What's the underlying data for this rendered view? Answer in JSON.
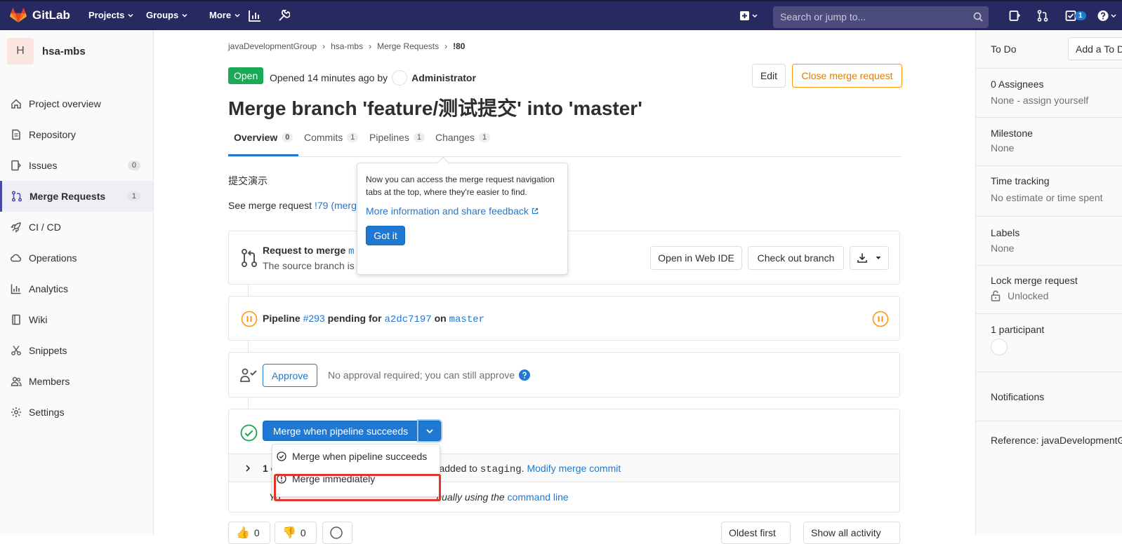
{
  "topbar": {
    "brand": "GitLab",
    "nav": [
      {
        "label": "Projects"
      },
      {
        "label": "Groups"
      },
      {
        "label": "More"
      }
    ],
    "search_placeholder": "Search or jump to...",
    "todo_count": "1",
    "colors": {
      "bg": "#292961",
      "accent": "#1f78d1"
    }
  },
  "sidebar": {
    "project_initial": "H",
    "project_name": "hsa-mbs",
    "items": [
      {
        "label": "Project overview",
        "icon": "home-icon"
      },
      {
        "label": "Repository",
        "icon": "document-icon"
      },
      {
        "label": "Issues",
        "icon": "issues-icon",
        "count": "0"
      },
      {
        "label": "Merge Requests",
        "icon": "merge-request-icon",
        "count": "1"
      },
      {
        "label": "CI / CD",
        "icon": "rocket-icon"
      },
      {
        "label": "Operations",
        "icon": "cloud-icon"
      },
      {
        "label": "Analytics",
        "icon": "chart-icon"
      },
      {
        "label": "Wiki",
        "icon": "book-icon"
      },
      {
        "label": "Snippets",
        "icon": "scissors-icon"
      },
      {
        "label": "Members",
        "icon": "users-icon"
      },
      {
        "label": "Settings",
        "icon": "gear-icon"
      }
    ]
  },
  "breadcrumb": [
    "javaDevelopmentGroup",
    "hsa-mbs",
    "Merge Requests",
    "!80"
  ],
  "mr": {
    "status": "Open",
    "opened_text": "Opened 14 minutes ago by",
    "author": "Administrator",
    "edit_label": "Edit",
    "close_label": "Close merge request",
    "title": "Merge branch 'feature/测试提交' into 'master'",
    "tabs": [
      {
        "label": "Overview",
        "count": "0"
      },
      {
        "label": "Commits",
        "count": "1"
      },
      {
        "label": "Pipelines",
        "count": "1"
      },
      {
        "label": "Changes",
        "count": "1"
      }
    ],
    "description": "提交演示",
    "see_prefix": "See merge request",
    "see_link": "!79 (merg"
  },
  "popover": {
    "text": "Now you can access the merge request navigation tabs at the top, where they're easier to find.",
    "link": "More information and share feedback",
    "button": "Got it"
  },
  "request_card": {
    "title": "Request to merge",
    "title_link": "m",
    "subtitle": "The source branch is",
    "web_ide_label": "Open in Web IDE",
    "checkout_label": "Check out branch"
  },
  "pipeline": {
    "prefix": "Pipeline",
    "id": "#293",
    "pending_for": "pending for",
    "commit": "a2dc7197",
    "on": "on",
    "branch": "master"
  },
  "approval": {
    "button": "Approve",
    "text": "No approval required; you can still approve"
  },
  "merge": {
    "button": "Merge when pipeline succeeds",
    "dropdown": [
      "Merge when pipeline succeeds",
      "Merge immediately"
    ],
    "commit_prefix": "1 c",
    "commit_text": "added to",
    "commit_branch": "staging",
    "modify_link": "Modify merge commit",
    "cli_prefix": "Yo",
    "cli_suffix": "nually using the",
    "cli_link": "command line"
  },
  "reactions": {
    "thumbs_up": "0",
    "thumbs_down": "0",
    "sort": "Oldest first",
    "filter": "Show all activity"
  },
  "right_sidebar": {
    "todo": "To Do",
    "add_todo": "Add a To D",
    "assignees": "0 Assignees",
    "assignees_value": "None - assign yourself",
    "milestone": "Milestone",
    "milestone_value": "None",
    "time_tracking": "Time tracking",
    "time_value": "No estimate or time spent",
    "labels": "Labels",
    "labels_value": "None",
    "lock": "Lock merge request",
    "lock_value": "Unlocked",
    "participants": "1 participant",
    "notifications": "Notifications",
    "reference": "Reference: javaDevelopmentG"
  }
}
